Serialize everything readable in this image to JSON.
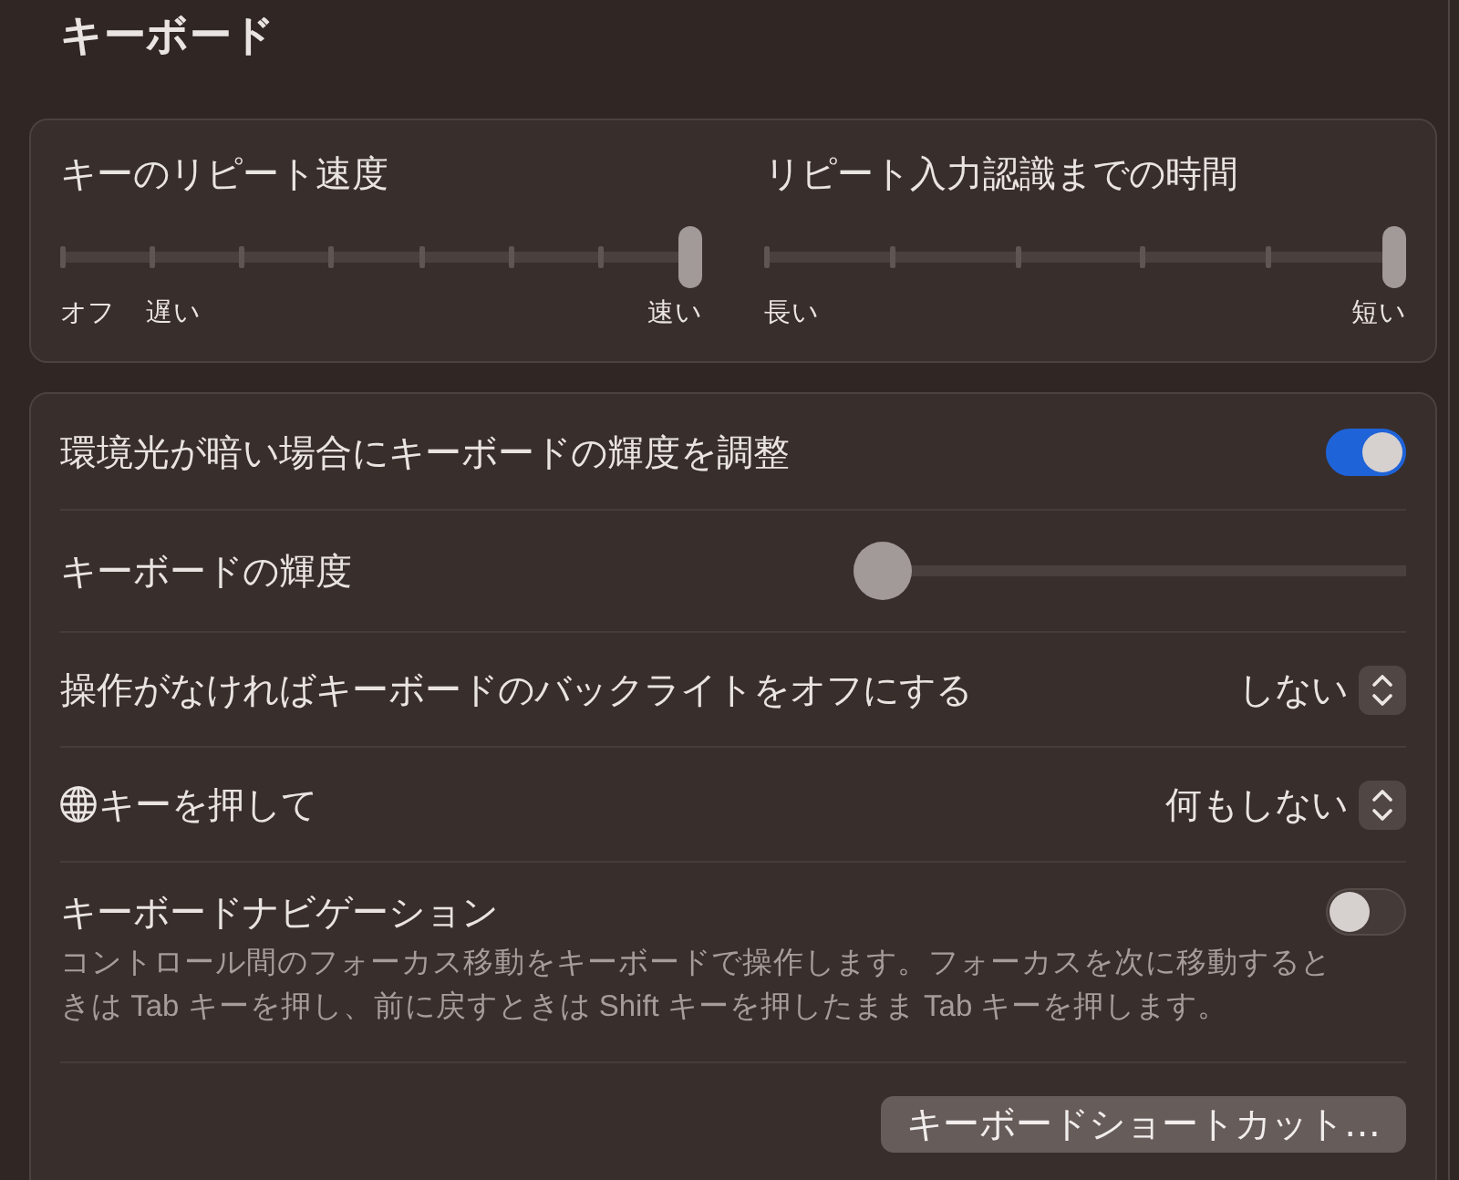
{
  "title": "キーボード",
  "repeat_sliders": [
    {
      "label": "キーのリピート速度",
      "level": 1,
      "tick_labels": [
        "オフ",
        "遅い",
        "速い"
      ]
    },
    {
      "label": "リピート入力認識までの時間",
      "level": 1,
      "tick_labels": [
        "長い",
        "短い"
      ]
    }
  ],
  "settings": [
    {
      "kind": "toggle",
      "label": "環境光が暗い場合にキーボードの輝度を調整",
      "on": true
    },
    {
      "kind": "slider",
      "label": "キーボードの輝度",
      "level": 0
    },
    {
      "kind": "popup",
      "label": "操作がなければキーボードのバックライトをオフにする",
      "value": "しない"
    },
    {
      "kind": "popup",
      "globe_icon": true,
      "label": "キーを押して",
      "value": "何もしない"
    },
    {
      "kind": "toggle",
      "label": "キーボードナビゲーション",
      "on": false,
      "description": "コントロール間のフォーカス移動をキーボードで操作します。フォーカスを次に移動するときは Tab キーを押し、前に戻すときは Shift キーを押したまま Tab キーを押します。"
    }
  ],
  "shortcuts_button": "キーボードショートカット…"
}
